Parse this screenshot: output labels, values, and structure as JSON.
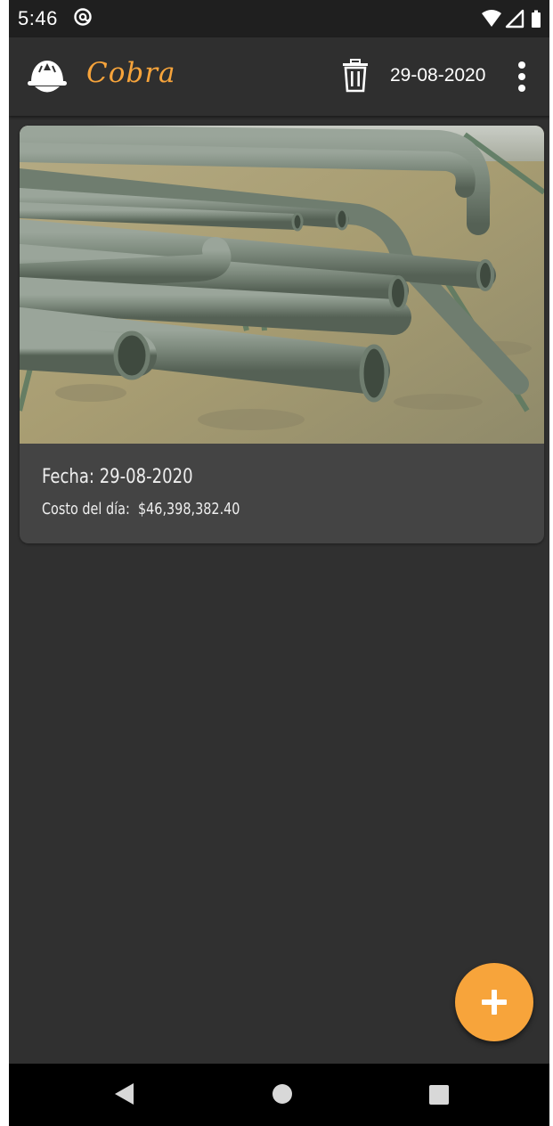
{
  "status_bar": {
    "time": "5:46",
    "icons": [
      "at-icon",
      "wifi-icon",
      "signal-icon",
      "battery-icon"
    ]
  },
  "app_bar": {
    "title": "Cobra",
    "date": "29-08-2020",
    "logo_icon": "hardhat-logo-icon",
    "delete_icon": "trash-icon",
    "menu_icon": "more-vert-icon"
  },
  "entry_card": {
    "image": "photo of green steel pipes on sandy ground",
    "date_line": "Fecha: 29-08-2020",
    "cost_label": "Costo del día:",
    "cost_value": "$46,398,382.40"
  },
  "fab": {
    "icon": "plus-icon"
  },
  "nav_bar": {
    "icons": [
      "back-icon",
      "home-icon",
      "recents-icon"
    ]
  },
  "colors": {
    "accent": "#f7a43b",
    "background": "#303030",
    "app_bar": "#2f2f2f",
    "card": "#444444",
    "status_bar": "#1f1f1f"
  }
}
